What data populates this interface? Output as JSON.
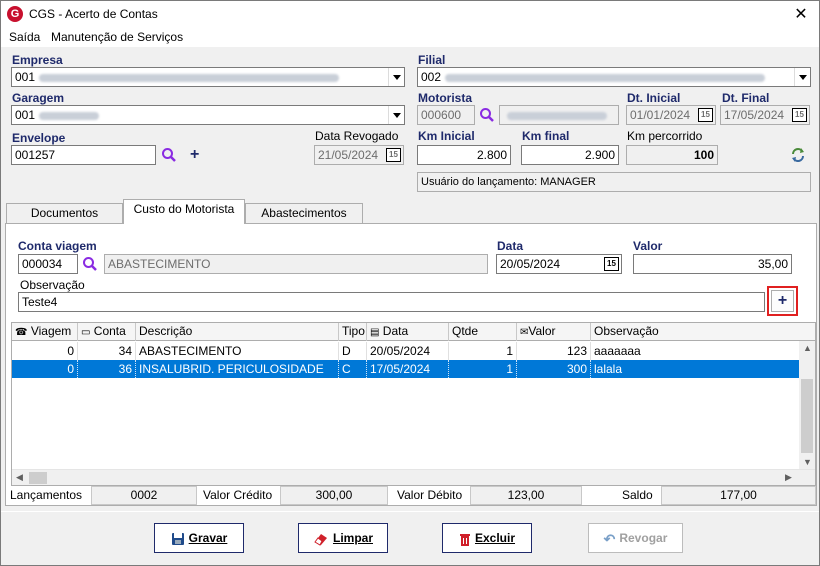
{
  "window": {
    "title": "CGS - Acerto de Contas"
  },
  "menu": [
    "Saída",
    "Manutenção de Serviços"
  ],
  "header": {
    "empresa_label": "Empresa",
    "empresa_value": "001",
    "filial_label": "Filial",
    "filial_value": "002",
    "garagem_label": "Garagem",
    "garagem_value": "001",
    "motorista_label": "Motorista",
    "motorista_value": "000600",
    "dt_inicial_label": "Dt. Inicial",
    "dt_inicial_value": "01/01/2024",
    "dt_final_label": "Dt. Final",
    "dt_final_value": "17/05/2024",
    "envelope_label": "Envelope",
    "envelope_value": "001257",
    "data_revogado_label": "Data Revogado",
    "data_revogado_value": "21/05/2024",
    "km_inicial_label": "Km Inicial",
    "km_inicial_value": "2.800",
    "km_final_label": "Km final",
    "km_final_value": "2.900",
    "km_percorrido_label": "Km percorrido",
    "km_percorrido_value": "100",
    "usuario_text": "Usuário do lançamento: MANAGER",
    "calendar_glyph": "15"
  },
  "tabs": [
    "Documentos",
    "Custo do Motorista",
    "Abastecimentos"
  ],
  "form": {
    "conta_label": "Conta viagem",
    "conta_value": "000034",
    "conta_desc": "ABASTECIMENTO",
    "data_label": "Data",
    "data_value": "20/05/2024",
    "valor_label": "Valor",
    "valor_value": "35,00",
    "obs_label": "Observação",
    "obs_value": "Teste4",
    "add_glyph": "+"
  },
  "grid": {
    "headers": [
      "Viagem",
      "Conta",
      "Descrição",
      "Tipo",
      "Data",
      "Qtde",
      "Valor",
      "Observação"
    ],
    "rows": [
      [
        "0",
        "34",
        "ABASTECIMENTO",
        "D",
        "20/05/2024",
        "1",
        "123",
        "aaaaaaa"
      ],
      [
        "0",
        "36",
        "INSALUBRID. PERICULOSIDADE",
        "C",
        "17/05/2024",
        "1",
        "300",
        "lalala"
      ]
    ],
    "selected_row": 1
  },
  "summary": {
    "lancamentos_label": "Lançamentos",
    "lancamentos_value": "0002",
    "credito_label": "Valor Crédito",
    "credito_value": "300,00",
    "debito_label": "Valor Débito",
    "debito_value": "123,00",
    "saldo_label": "Saldo",
    "saldo_value": "177,00"
  },
  "buttons": {
    "gravar": "Gravar",
    "limpar": "Limpar",
    "excluir": "Excluir",
    "revogar": "Revogar"
  },
  "colors": {
    "accent": "#1f2a6b",
    "selection": "#0078d7",
    "highlight": "#e02020",
    "search_icon": "#8a2be2"
  }
}
